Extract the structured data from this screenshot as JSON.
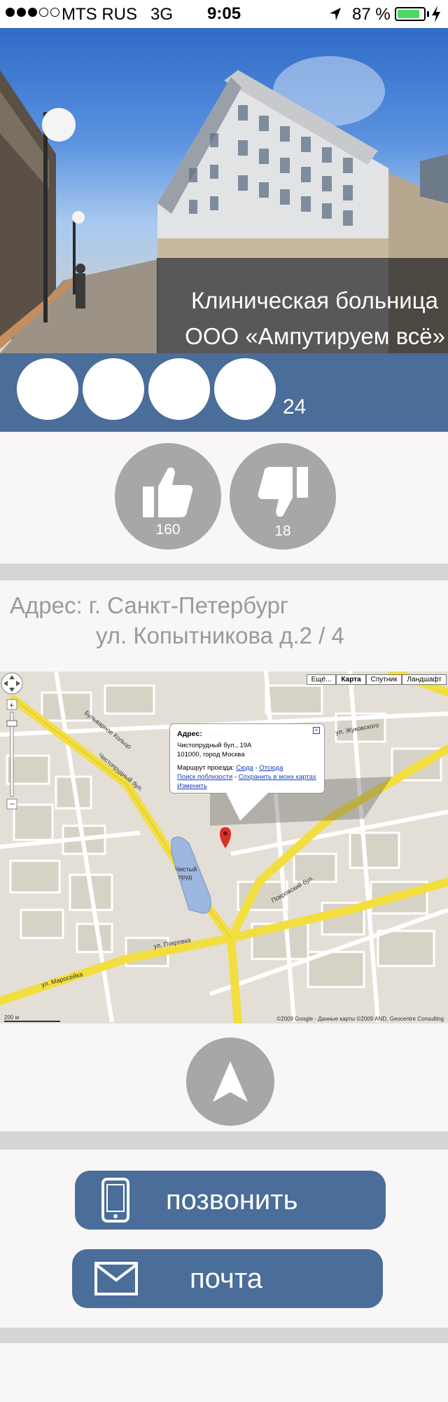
{
  "status_bar": {
    "carrier": "MTS RUS",
    "network": "3G",
    "time": "9:05",
    "battery_percent": "87 %",
    "battery_level": 0.87,
    "signal_bars": 3,
    "signal_total": 5
  },
  "hero": {
    "title_line1": "Клиническая больница",
    "title_line2": "ООО «Ампутируем всё»"
  },
  "rating": {
    "stars_total": 4,
    "count": "24"
  },
  "votes": {
    "likes": "160",
    "dislikes": "18"
  },
  "address": {
    "line1": "Адрес: г. Санкт-Петербург",
    "line2": "ул. Копытникова д.2 / 4"
  },
  "map": {
    "type_buttons": [
      "Ещё...",
      "Карта",
      "Спутник",
      "Ландшафт"
    ],
    "selected_type": "Карта",
    "popup": {
      "heading": "Адрес:",
      "street": "Чистопрудный бул., 19А",
      "city": "101000, город Москва",
      "route_label": "Маршрут проезда:",
      "route_to": "Сюда",
      "route_from": "Отсюда",
      "nearby": "Поиск поблизости",
      "save": "Сохранить в моих картах",
      "edit": "Изменить"
    },
    "pond_label": "Чистый пруд",
    "street_labels": [
      "Чистопрудный бул.",
      "ул. Покровка",
      "ул. Маросейка",
      "Бульварное Кольцо",
      "Покровский бул.",
      "ул. Жуковского"
    ],
    "scale": "200 м",
    "copyright": "©2009 Google - Данные карты ©2009 AND, Geocentre Consulting"
  },
  "contact": {
    "call_label": "позвонить",
    "mail_label": "почта"
  },
  "colors": {
    "accent": "#4a6d99",
    "button_grey": "#a7a7a7",
    "separator": "#d6d6d6",
    "background": "#f8f6f6"
  },
  "icons": {
    "like": "thumbs-up-icon",
    "dislike": "thumbs-down-icon",
    "navigate": "navigation-arrow-icon",
    "call": "phone-icon",
    "mail": "envelope-icon"
  }
}
